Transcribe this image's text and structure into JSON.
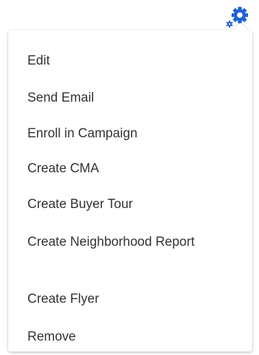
{
  "gear_menu": {
    "icon": "gear-icon",
    "accent_color": "#1f63d6",
    "items": [
      {
        "label": "Edit"
      },
      {
        "label": "Send Email"
      },
      {
        "label": "Enroll in Campaign"
      },
      {
        "label": "Create CMA"
      },
      {
        "label": "Create Buyer Tour"
      },
      {
        "label": "Create Neighborhood Report"
      },
      {
        "label": "Create Flyer"
      },
      {
        "label": "Remove"
      }
    ]
  }
}
